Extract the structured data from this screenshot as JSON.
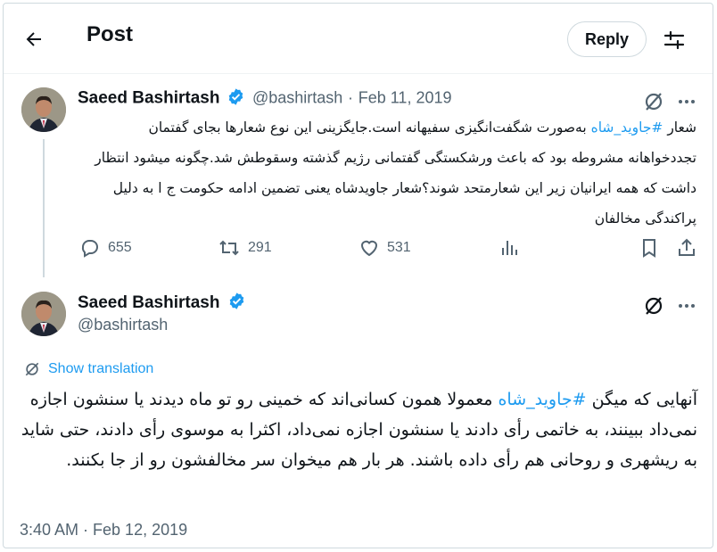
{
  "header": {
    "title": "Post",
    "reply_label": "Reply"
  },
  "tweet1": {
    "name": "Saeed Bashirtash",
    "handle": "@bashirtash",
    "separator": "·",
    "date": "Feb 11, 2019",
    "text_before": "شعار ",
    "hashtag": "#جاوید_شاه",
    "text_after": " به‌صورت شگفت‌انگیزی سفیهانه است.جایگزینی این نوع شعارها بجای گفتمان تجددخواهانه مشروطه بود که باعث ورشکستگی گفتمانی رژیم گذشته وسقوطش شد.چگونه میشود انتظار داشت که همه ایرانیان زیر این شعارمتحد شوند؟شعار جاویدشاه یعنی تضمین ادامه حکومت ج ا به دلیل پراکندگی مخالفان",
    "replies": "655",
    "reposts": "291",
    "likes": "531"
  },
  "tweet2": {
    "name": "Saeed Bashirtash",
    "handle": "@bashirtash",
    "show_translation": "Show translation",
    "text_before": "آنهایی که میگن ",
    "hashtag": "#جاوید_شاه",
    "text_after": " معمولا همون کسانی‌اند که خمینی رو تو ماه دیدند یا سنشون اجازه نمی‌داد ببینند، به خاتمی رأی دادند یا سنشون اجازه نمی‌داد، اکثرا به موسوی رأی دادند، حتی شاید به ریشهری و روحانی هم رأی داده باشند. هر بار هم میخوان سر مخالفشون رو از جا بکنند.",
    "timestamp": "3:40 AM · Feb 12, 2019"
  },
  "icons": {
    "back": "arrow-left-icon",
    "filter": "sliders-icon",
    "verified": "verified-badge-icon",
    "grok": "slashed-circle-icon",
    "more": "more-dots-icon",
    "reply": "speech-bubble-icon",
    "repost": "repost-arrows-icon",
    "like": "heart-icon",
    "views": "bar-chart-icon",
    "bookmark": "bookmark-icon",
    "share": "share-icon",
    "translate": "translate-icon"
  },
  "colors": {
    "accent": "#1d9bf0",
    "muted": "#536471",
    "text": "#0f1419",
    "border": "#cfd9de"
  }
}
